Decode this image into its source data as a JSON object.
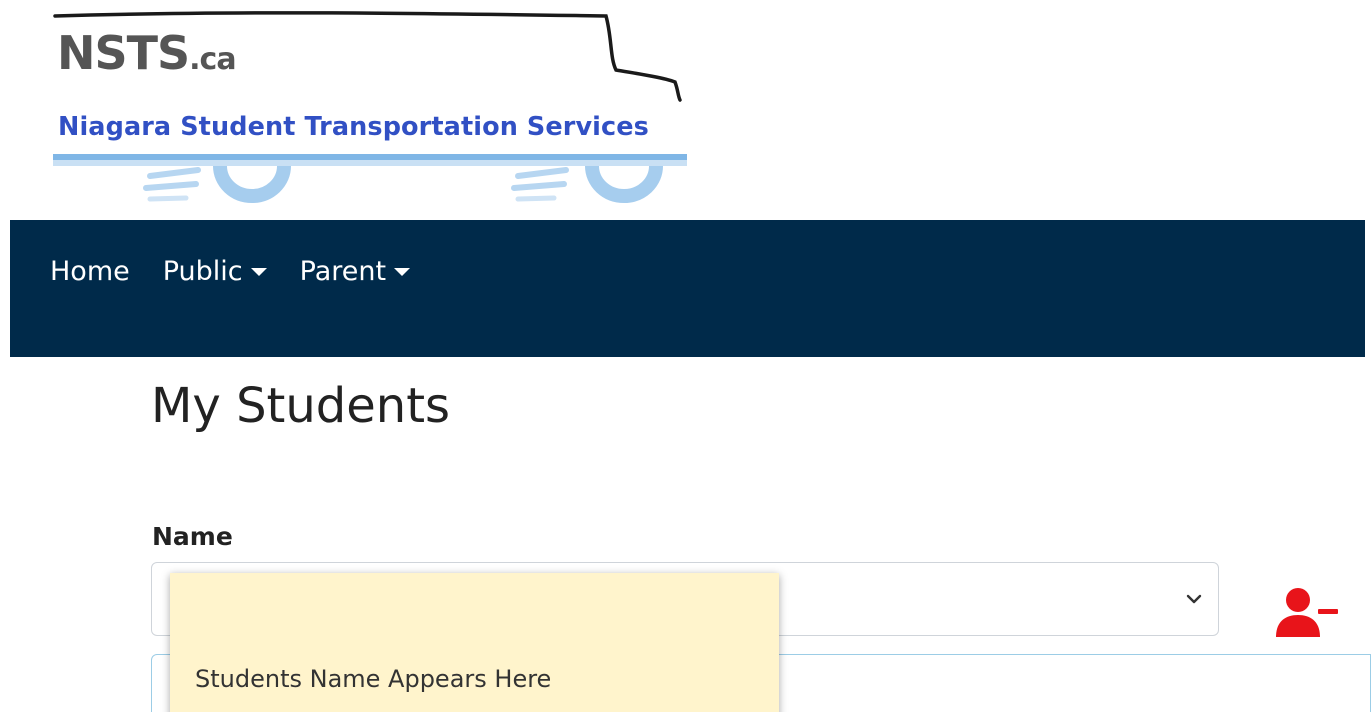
{
  "logo": {
    "mark_main": "NSTS",
    "mark_suffix": ".ca",
    "subtitle": "Niagara Student Transportation Services"
  },
  "nav": {
    "items": [
      {
        "label": "Home"
      },
      {
        "label": "Public",
        "dropdown": true
      },
      {
        "label": "Parent",
        "dropdown": true
      }
    ]
  },
  "page": {
    "title": "My Students"
  },
  "form": {
    "name_label": "Name",
    "name_select_value": ""
  },
  "tooltip": {
    "text": "Students Name Appears Here"
  },
  "icons": {
    "remove_student": "remove-user-icon",
    "select_chevron": "chevron-down-icon",
    "nav_caret": "caret-down-icon"
  },
  "colors": {
    "navbar_bg": "#002a4a",
    "brand_blue": "#3150c4",
    "remove_icon": "#e8141a",
    "tooltip_bg": "#fff4cc",
    "panel_border": "#9ccde6"
  }
}
